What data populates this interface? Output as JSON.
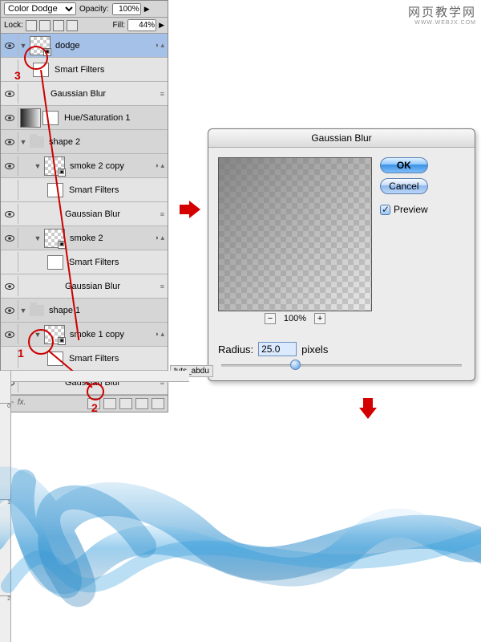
{
  "watermark": {
    "cn": "网页教学网",
    "en": "WWW.WEBJX.COM"
  },
  "panel": {
    "blend_mode": "Color Dodge",
    "opacity_label": "Opacity:",
    "opacity_value": "100%",
    "lock_label": "Lock:",
    "fill_label": "Fill:",
    "fill_value": "44%",
    "layers": [
      {
        "name": "dodge",
        "kind": "smart",
        "selected": true
      },
      {
        "name": "Smart Filters",
        "kind": "sf"
      },
      {
        "name": "Gaussian Blur",
        "kind": "filter"
      },
      {
        "name": "Hue/Saturation 1",
        "kind": "adj"
      },
      {
        "name": "shape 2",
        "kind": "group"
      },
      {
        "name": "smoke 2 copy",
        "kind": "smart",
        "indent": 1
      },
      {
        "name": "Smart Filters",
        "kind": "sf",
        "indent": 2
      },
      {
        "name": "Gaussian Blur",
        "kind": "filter",
        "indent": 2
      },
      {
        "name": "smoke 2",
        "kind": "smart",
        "indent": 1
      },
      {
        "name": "Smart Filters",
        "kind": "sf",
        "indent": 2
      },
      {
        "name": "Gaussian Blur",
        "kind": "filter",
        "indent": 2
      },
      {
        "name": "shape 1",
        "kind": "group"
      },
      {
        "name": "smoke 1 copy",
        "kind": "smart",
        "indent": 1
      },
      {
        "name": "Smart Filters",
        "kind": "sf",
        "indent": 2
      },
      {
        "name": "Gaussian Blur",
        "kind": "filter",
        "indent": 2
      }
    ]
  },
  "tab_label": "tuts_abdu",
  "annotations": {
    "n1": "1",
    "n2": "2",
    "n3": "3"
  },
  "dialog": {
    "title": "Gaussian Blur",
    "ok": "OK",
    "cancel": "Cancel",
    "preview_label": "Preview",
    "zoom_out": "−",
    "zoom_pct": "100%",
    "zoom_in": "+",
    "radius_label": "Radius:",
    "radius_value": "25.0",
    "radius_unit": "pixels"
  },
  "ruler_ticks": [
    "0",
    "1",
    "2"
  ]
}
